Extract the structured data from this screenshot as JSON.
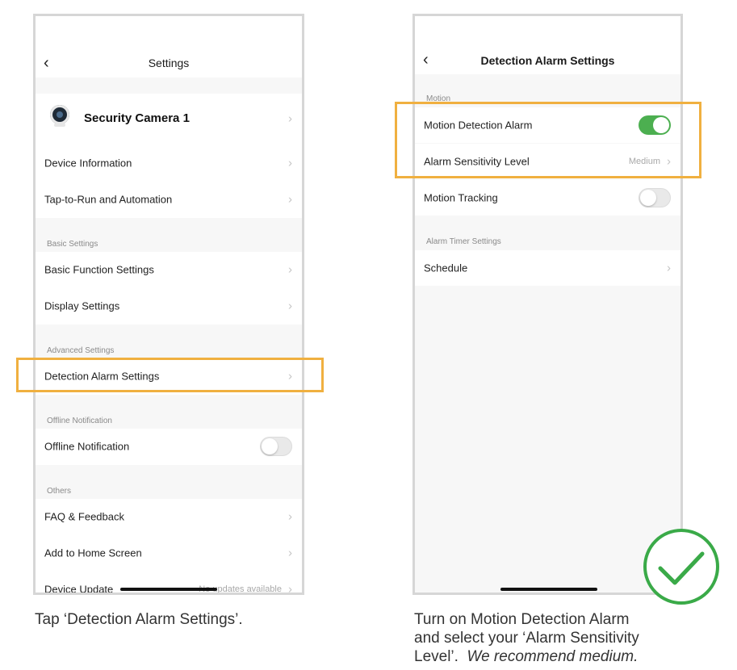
{
  "colors": {
    "accent_highlight": "#f0b040",
    "toggle_on": "#4caf50",
    "check_green": "#3aaa48"
  },
  "left_phone": {
    "back_icon": "chevron-left-icon",
    "title": "Settings",
    "device_name": "Security Camera 1",
    "rows_top": [
      {
        "label": "Device Information"
      },
      {
        "label": "Tap-to-Run and Automation"
      }
    ],
    "basic": {
      "header": "Basic Settings",
      "rows": [
        {
          "label": "Basic Function Settings"
        },
        {
          "label": "Display Settings"
        }
      ]
    },
    "advanced": {
      "header": "Advanced Settings",
      "rows": [
        {
          "label": "Detection Alarm Settings"
        }
      ]
    },
    "offline": {
      "header": "Offline Notification",
      "row_label": "Offline Notification",
      "toggle": "off"
    },
    "others": {
      "header": "Others",
      "rows": [
        {
          "label": "FAQ & Feedback"
        },
        {
          "label": "Add to Home Screen"
        }
      ],
      "update_label": "Device Update",
      "update_value": "No updates available"
    }
  },
  "right_phone": {
    "back_icon": "chevron-left-icon",
    "title": "Detection Alarm Settings",
    "motion": {
      "header": "Motion",
      "alarm_label": "Motion Detection Alarm",
      "alarm_toggle": "on",
      "sensitivity_label": "Alarm Sensitivity Level",
      "sensitivity_value": "Medium",
      "tracking_label": "Motion Tracking",
      "tracking_toggle": "off"
    },
    "timer": {
      "header": "Alarm Timer Settings",
      "schedule_label": "Schedule"
    }
  },
  "captions": {
    "left": "Tap ‘Detection Alarm Settings’.",
    "right_line1": "Turn on Motion Detection Alarm",
    "right_line2": "and select your ‘Alarm Sensitivity",
    "right_line3": "Level’.",
    "right_emphasis": "We recommend medium."
  },
  "chevron": "›",
  "check_icon": "check-circle-icon"
}
